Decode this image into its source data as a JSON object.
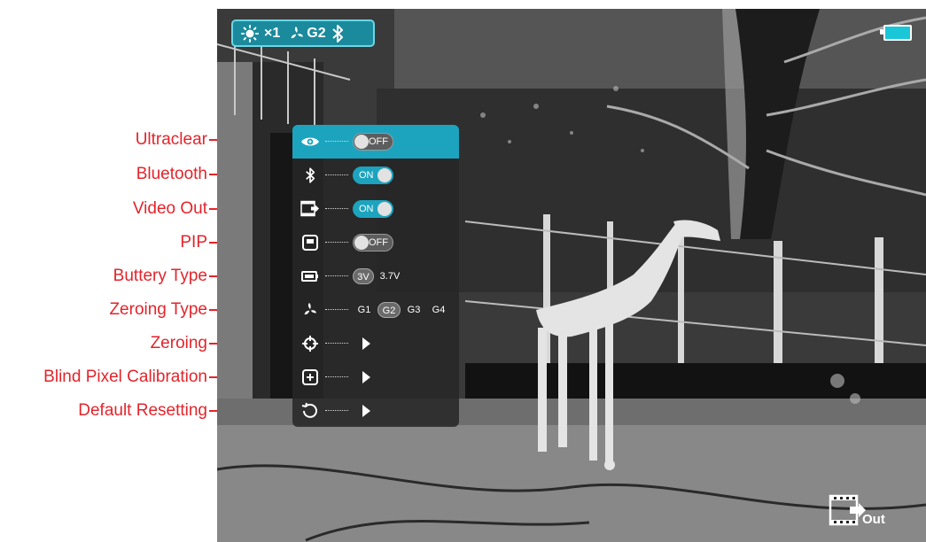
{
  "annotations": [
    {
      "label": "Ultraclear"
    },
    {
      "label": "Bluetooth"
    },
    {
      "label": "Video Out"
    },
    {
      "label": "PIP"
    },
    {
      "label": "Buttery Type"
    },
    {
      "label": "Zeroing Type"
    },
    {
      "label": "Zeroing"
    },
    {
      "label": "Blind Pixel Calibration"
    },
    {
      "label": "Default Resetting"
    }
  ],
  "status_bar": {
    "brightness_icon": "sun-icon",
    "zoom": "×1",
    "zeroing_icon": "zeroing-fan-icon",
    "zeroing_profile": "G2",
    "bluetooth_icon": "bluetooth-icon"
  },
  "battery": {
    "icon": "battery-icon",
    "level": 0.9,
    "color": "#19c7d9"
  },
  "video_out_indicator": {
    "icon": "video-out-icon",
    "label": "Out"
  },
  "menu": {
    "ultraclear": {
      "icon": "eye-icon",
      "state": "OFF"
    },
    "bluetooth": {
      "icon": "bluetooth-icon",
      "state": "ON"
    },
    "video_out": {
      "icon": "video-out-icon",
      "state": "ON"
    },
    "pip": {
      "icon": "pip-icon",
      "state": "OFF"
    },
    "battery_type": {
      "icon": "battery-icon",
      "options": [
        "3V",
        "3.7V"
      ],
      "selected": "3V"
    },
    "zeroing_type": {
      "icon": "zeroing-fan-icon",
      "options": [
        "G1",
        "G2",
        "G3",
        "G4"
      ],
      "selected": "G2"
    },
    "zeroing": {
      "icon": "crosshair-icon"
    },
    "blind_pixel": {
      "icon": "plus-square-icon"
    },
    "default_reset": {
      "icon": "reset-icon"
    }
  },
  "colors": {
    "accent": "#1ca4bf",
    "annotation": "#e3242b",
    "menu_bg": "#262626"
  }
}
